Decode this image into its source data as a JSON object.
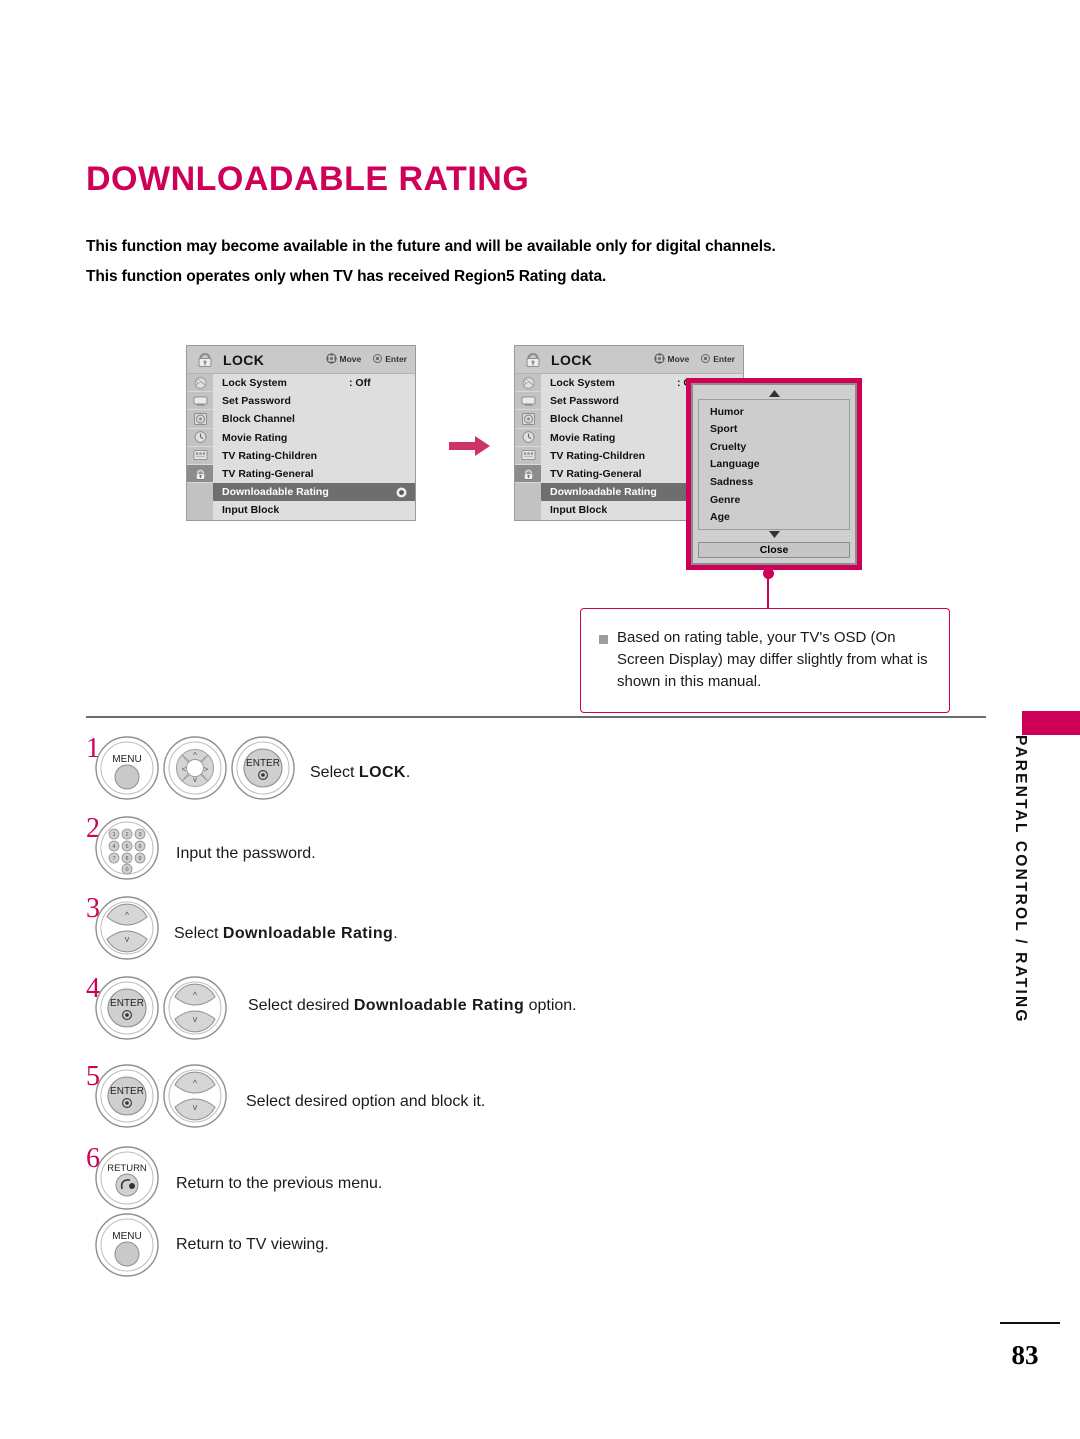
{
  "page": {
    "title": "DOWNLOADABLE RATING",
    "number": "83",
    "side_tab": "PARENTAL CONTROL / RATING"
  },
  "intro": {
    "line1": "This function may become available in the future and will be available only for digital channels.",
    "line2": "This function operates only when TV has received Region5 Rating data."
  },
  "osd_menu": {
    "title": "LOCK",
    "hint_move": "Move",
    "hint_enter": "Enter",
    "items": [
      {
        "label": "Lock System",
        "value": ": Off"
      },
      {
        "label": "Set Password",
        "value": ""
      },
      {
        "label": "Block Channel",
        "value": ""
      },
      {
        "label": "Movie Rating",
        "value": ""
      },
      {
        "label": "TV Rating-Children",
        "value": ""
      },
      {
        "label": "TV Rating-General",
        "value": ""
      },
      {
        "label": "Downloadable Rating",
        "value": ""
      },
      {
        "label": "Input Block",
        "value": ""
      }
    ],
    "selected_index": 6,
    "icon_column": [
      "picture-icon",
      "screen-icon",
      "audio-icon",
      "time-icon",
      "option-icon",
      "lock-icon"
    ]
  },
  "dropdown": {
    "items": [
      "Humor",
      "Sport",
      "Cruelty",
      "Language",
      "Sadness",
      "Genre",
      "Age"
    ],
    "close_label": "Close",
    "scroll_up": "▲",
    "scroll_down": "▼"
  },
  "note": {
    "text": "Based on rating table, your TV's OSD (On Screen Display) may differ slightly from what is shown in this manual."
  },
  "steps": [
    {
      "num": "1",
      "text_prefix": "Select ",
      "text_bold": "LOCK",
      "text_suffix": "."
    },
    {
      "num": "2",
      "text_prefix": "Input the password.",
      "text_bold": "",
      "text_suffix": ""
    },
    {
      "num": "3",
      "text_prefix": "Select ",
      "text_bold": "Downloadable  Rating",
      "text_suffix": "."
    },
    {
      "num": "4",
      "text_prefix": "Select desired ",
      "text_bold": "Downloadable Rating",
      "text_suffix": " option."
    },
    {
      "num": "5",
      "text_prefix": "Select desired option and block it.",
      "text_bold": "",
      "text_suffix": ""
    },
    {
      "num": "6",
      "text_prefix": "Return to the previous menu.",
      "text_bold": "",
      "text_suffix": ""
    },
    {
      "num": "",
      "text_prefix": "Return to TV viewing.",
      "text_bold": "",
      "text_suffix": ""
    }
  ],
  "buttons": {
    "menu": "MENU",
    "enter": "ENTER",
    "return": "RETURN",
    "keypad": [
      "1",
      "2",
      "3",
      "4",
      "5",
      "6",
      "7",
      "8",
      "9",
      "0"
    ]
  },
  "colors": {
    "accent": "#CE0058",
    "osd_bg": "#d6d6d6",
    "osd_selected": "#6e6e6e"
  }
}
